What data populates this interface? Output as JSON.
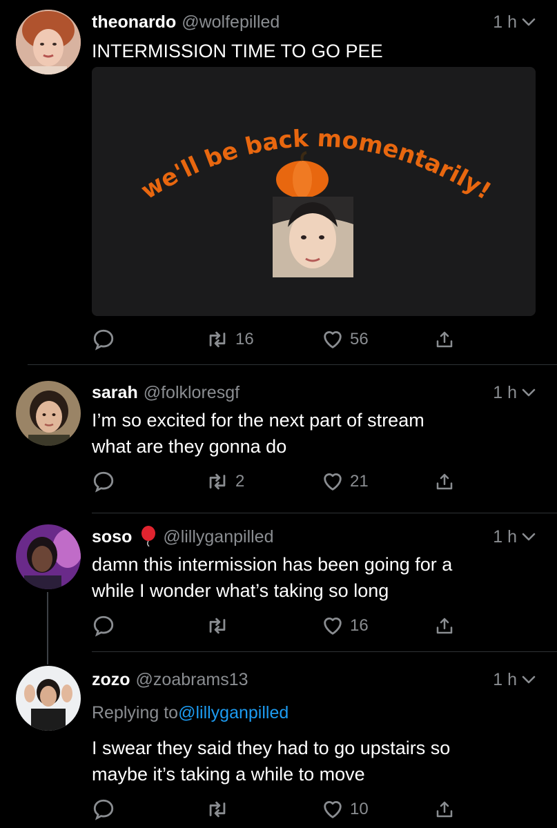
{
  "tweets": [
    {
      "name": "theonardo",
      "handle": "@wolfepilled",
      "time": "1 h",
      "text": "INTERMISSION TIME TO GO PEE",
      "media": {
        "banner_text": "we'll be back momentarily!"
      },
      "stats": {
        "retweets": "16",
        "likes": "56"
      }
    },
    {
      "name": "sarah",
      "handle": "@folkloresgf",
      "time": "1 h",
      "text_line1": "I’m so excited for the next part of stream",
      "text_line2": "what are they gonna do",
      "stats": {
        "retweets": "2",
        "likes": "21"
      }
    },
    {
      "name": "soso",
      "handle": "@lillyganpilled",
      "time": "1 h",
      "text_line1": "damn this intermission has been going for a",
      "text_line2": "while I wonder what’s taking so long",
      "stats": {
        "retweets": "",
        "likes": "16"
      }
    },
    {
      "name": "zozo",
      "handle": "@zoabrams13",
      "time": "1 h",
      "replying_label": "Replying to",
      "replying_handle": "@lillyganpilled",
      "text_line1": "I swear they said they had to go upstairs so",
      "text_line2": "maybe it’s taking a while to move",
      "stats": {
        "retweets": "",
        "likes": "10"
      }
    }
  ],
  "colors": {
    "accent": "#1d9bf0",
    "muted": "#8a8d91",
    "pumpkin": "#e8670f"
  }
}
